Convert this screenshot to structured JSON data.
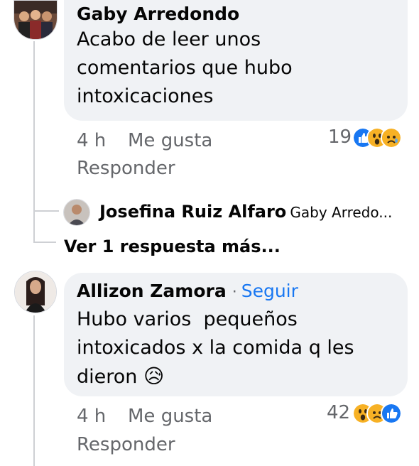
{
  "comment1": {
    "author": "Gaby Arredondo",
    "text_lines": [
      "Acabo de leer unos",
      "comentarios que hubo",
      "intoxicaciones"
    ],
    "time": "4 h",
    "like_label": "Me gusta",
    "reply_label": "Responder",
    "reaction_count": "19",
    "reactions": [
      "like-reaction-icon",
      "wow-reaction-icon",
      "sad-reaction-icon"
    ]
  },
  "reply_preview": {
    "author": "Josefina Ruiz Alfaro",
    "snippet": "Gaby Arredo..."
  },
  "more_replies": "Ver 1 respuesta más...",
  "comment2": {
    "author": "Allizon Zamora",
    "separator": "·",
    "follow_label": "Seguir",
    "text_lines": [
      "Hubo varios  pequeños",
      "intoxicados x la comida q les",
      "dieron "
    ],
    "emoji": "😥",
    "time": "4 h",
    "like_label": "Me gusta",
    "reply_label": "Responder",
    "reaction_count": "42",
    "reactions": [
      "wow-reaction-icon",
      "sad-reaction-icon",
      "like-reaction-icon"
    ]
  },
  "colors": {
    "bubble": "#f0f2f5",
    "link_blue": "#1877f2",
    "muted": "#65676b",
    "like_blue": "#1877f2",
    "emoji_yellow": "#f7b125"
  }
}
